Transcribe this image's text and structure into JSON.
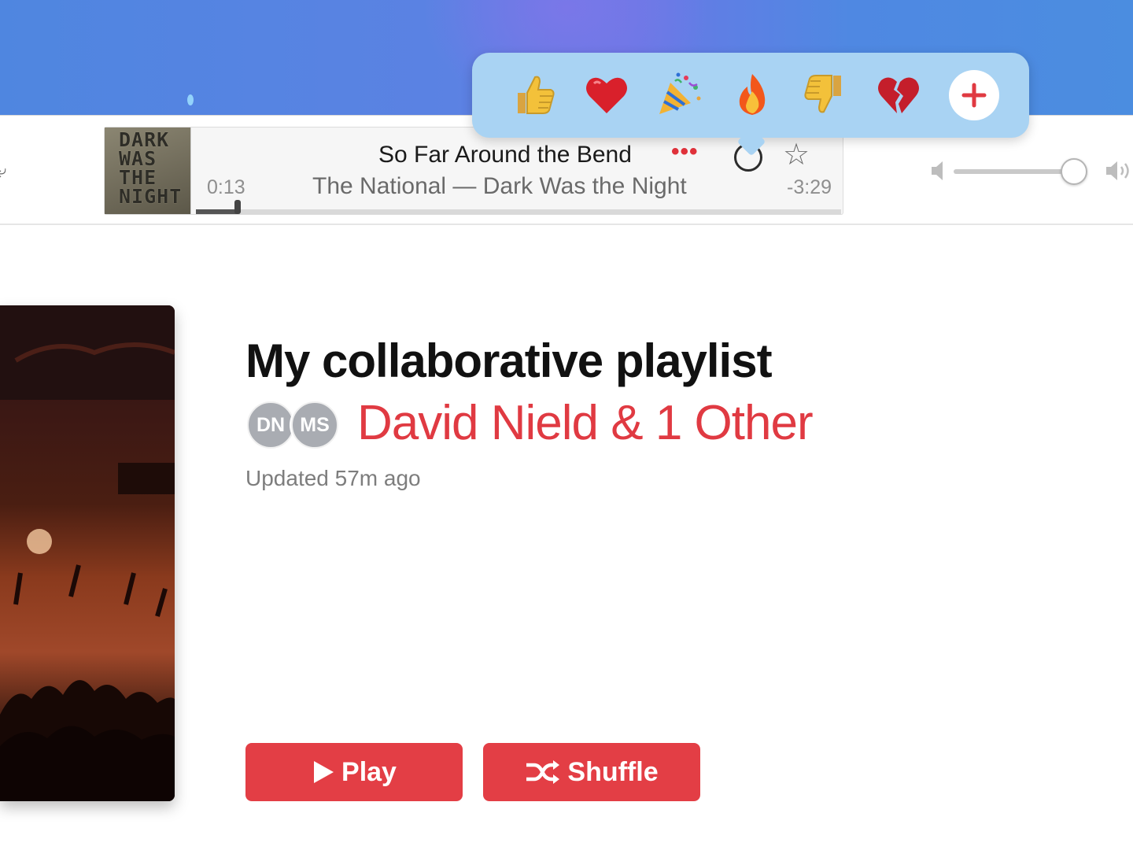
{
  "now_playing": {
    "artwork_text": [
      "DARK",
      "WAS",
      "THE",
      "NIGHT"
    ],
    "elapsed": "0:13",
    "remaining": "-3:29",
    "title": "So Far Around the Bend",
    "more_label": "•••",
    "subtitle": "The National — Dark Was the Night",
    "progress_fraction": 0.065
  },
  "volume": {
    "level_fraction": 0.9
  },
  "reactions": {
    "emojis": [
      "👍",
      "❤️",
      "🎉",
      "🔥",
      "👎",
      "💔"
    ],
    "add_label": "+",
    "accent": "#e03a42"
  },
  "playlist": {
    "title": "My collaborative playlist",
    "avatars": [
      "DN",
      "MS"
    ],
    "owner": "David Nield & 1 Other",
    "updated": "Updated 57m ago",
    "play_label": "Play",
    "shuffle_label": "Shuffle"
  },
  "colors": {
    "accent_red": "#e33e45",
    "popover_bg": "#a9d3f3"
  }
}
